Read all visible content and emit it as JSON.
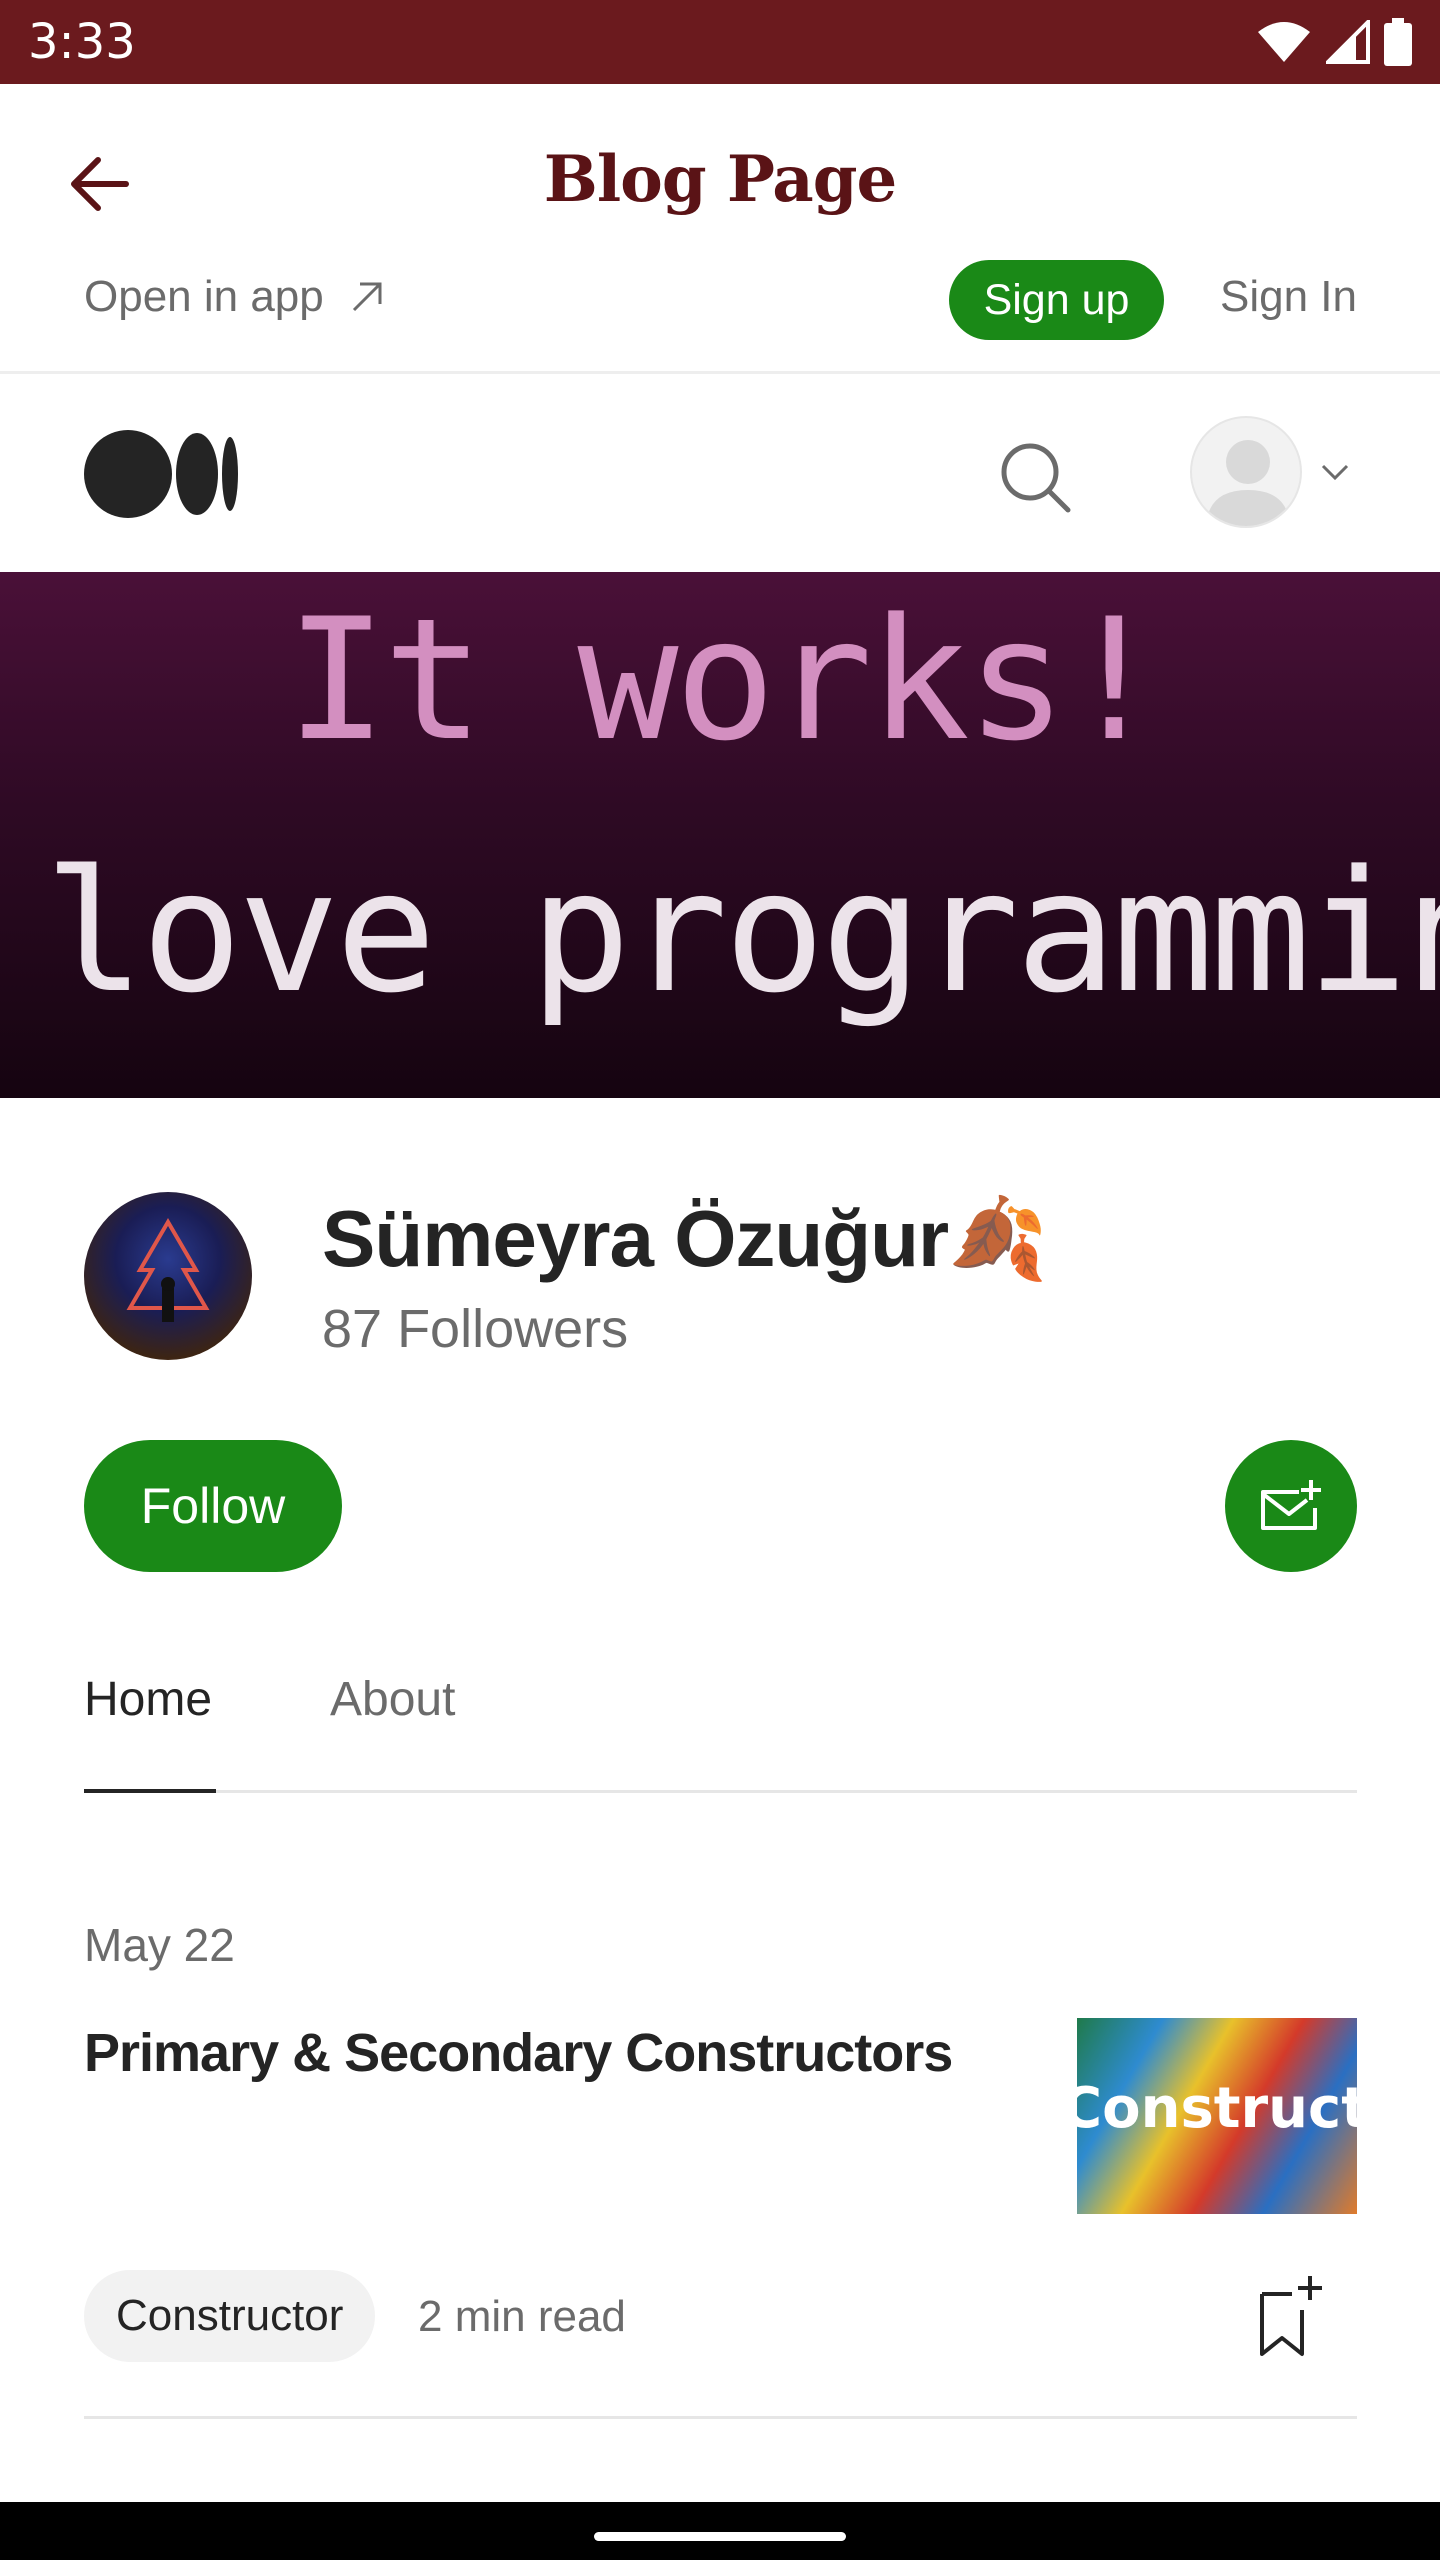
{
  "status_bar": {
    "time": "3:33"
  },
  "app_bar": {
    "title": "Blog Page",
    "open_in_app": "Open in app",
    "sign_up": "Sign up",
    "sign_in": "Sign In"
  },
  "banner": {
    "line1": "It works!",
    "line2": "love programming"
  },
  "profile": {
    "name": "Sümeyra Özuğur🍂",
    "followers": "87 Followers",
    "follow_label": "Follow"
  },
  "tabs": [
    {
      "label": "Home",
      "active": true
    },
    {
      "label": "About",
      "active": false
    }
  ],
  "post": {
    "date": "May 22",
    "title": "Primary & Secondary Constructors",
    "thumbnail_text": "Constructor",
    "tag": "Constructor",
    "read_time": "2 min read"
  },
  "icons": {
    "back": "arrow-left-icon",
    "external": "arrow-up-right-icon",
    "search": "search-icon",
    "avatar": "user-avatar-icon",
    "dropdown": "chevron-down-icon",
    "subscribe": "mail-plus-icon",
    "bookmark": "bookmark-plus-icon"
  },
  "colors": {
    "status_bar": "#6b1a1e",
    "title": "#5a1316",
    "accent_green": "#1a8917",
    "text_primary": "#242424",
    "text_secondary": "#6b6b6b"
  }
}
